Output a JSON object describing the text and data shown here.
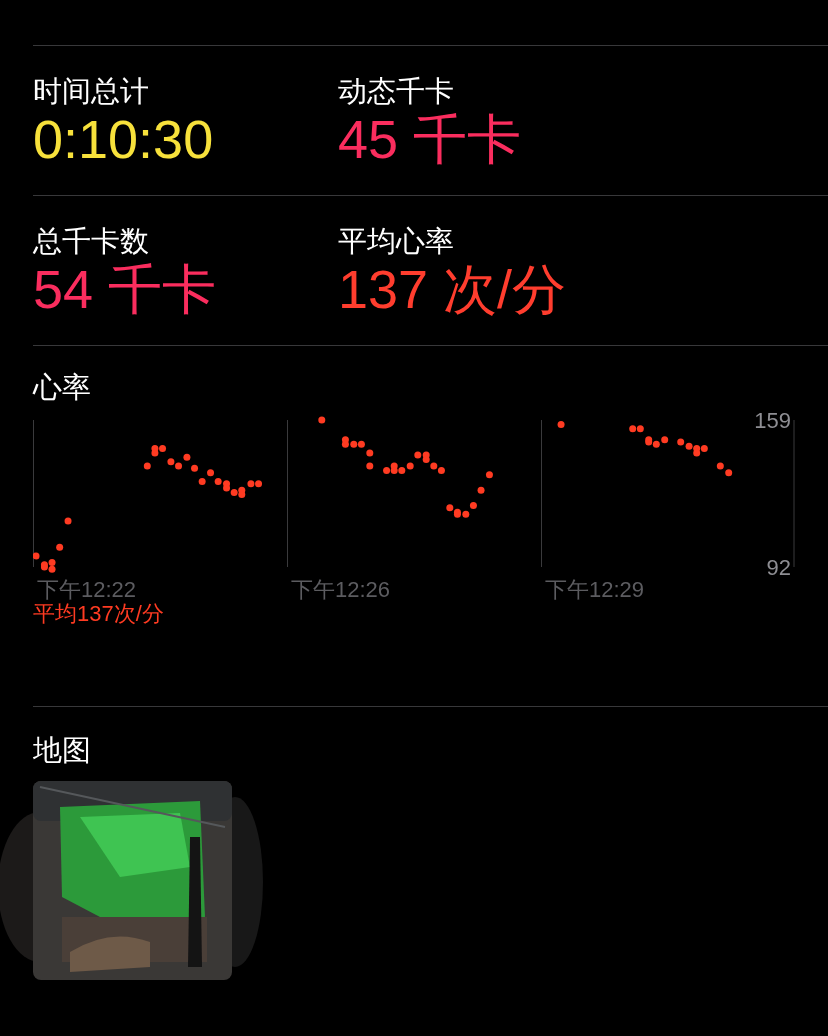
{
  "stats": [
    {
      "label": "时间总计",
      "value": "0:10:30",
      "color": "#f7e13b"
    },
    {
      "label": "动态千卡",
      "value": "45 千卡",
      "color": "#fa2d5e"
    },
    {
      "label": "总千卡数",
      "value": "54 千卡",
      "color": "#fa2d5e"
    },
    {
      "label": "平均心率",
      "value": "137 次/分",
      "color": "#ff3d2e"
    }
  ],
  "heart_rate": {
    "title": "心率",
    "axis_labels": [
      "159",
      "92"
    ],
    "time_labels": [
      "下午12:22",
      "下午12:26",
      "下午12:29"
    ],
    "average": "平均137次/分"
  },
  "map": {
    "title": "地图",
    "kind": "picture"
  }
}
